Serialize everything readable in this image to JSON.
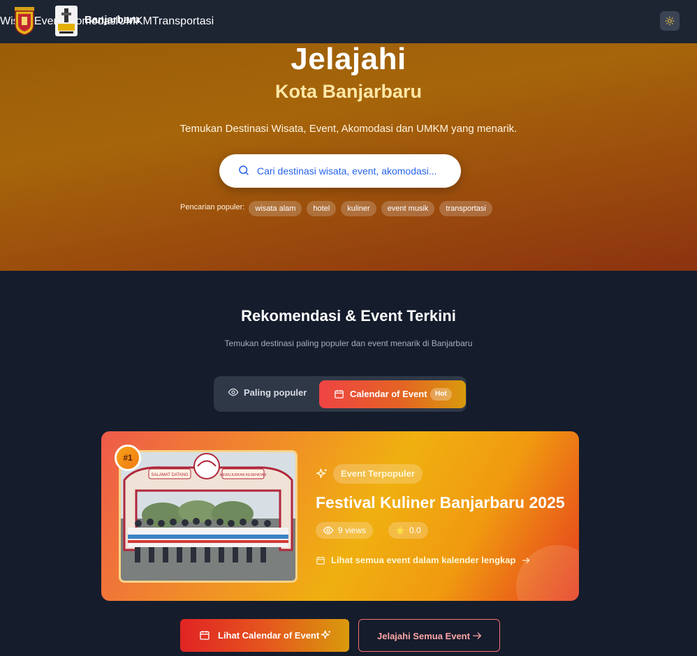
{
  "nav": {
    "brand": "Banjarbaru",
    "menu": [
      "Wisata",
      "Event",
      "Akomodasi",
      "UMKM",
      "Transportasi"
    ]
  },
  "hero": {
    "title": "Jelajahi",
    "subtitle": "Kota Banjarbaru",
    "tagline": "Temukan Destinasi Wisata, Event, Akomodasi dan UMKM yang menarik.",
    "search_placeholder": "Cari destinasi wisata, event, akomodasi...",
    "popular_label": "Pencarian populer:",
    "popular_chips": [
      "wisata alam",
      "hotel",
      "kuliner",
      "event musik",
      "transportasi"
    ]
  },
  "section": {
    "title": "Rekomendasi & Event Terkini",
    "subtitle": "Temukan destinasi paling populer dan event menarik di Banjarbaru"
  },
  "tabs": {
    "popular": "Paling populer",
    "calendar": "Calendar of Event",
    "hot": "Hot"
  },
  "featured": {
    "rank": "#1",
    "badge": "Event Terpopuler",
    "title": "Festival Kuliner Banjarbaru 2025",
    "views": "9 views",
    "rating": "0.0",
    "calendar_link": "Lihat semua event dalam kalender lengkap",
    "photo_arch_left": "SALAMAT DATANG",
    "photo_arch_right": "MEWUJUDKAN KESEHATAN"
  },
  "buttons": {
    "calendar": "Lihat Calendar of Event",
    "all_events": "Jelajahi Semua Event"
  },
  "colors": {
    "nav_bg": "#1d2533",
    "page_bg": "#151c2c",
    "accent_red": "#ef4444",
    "accent_amber": "#d99a0c"
  }
}
